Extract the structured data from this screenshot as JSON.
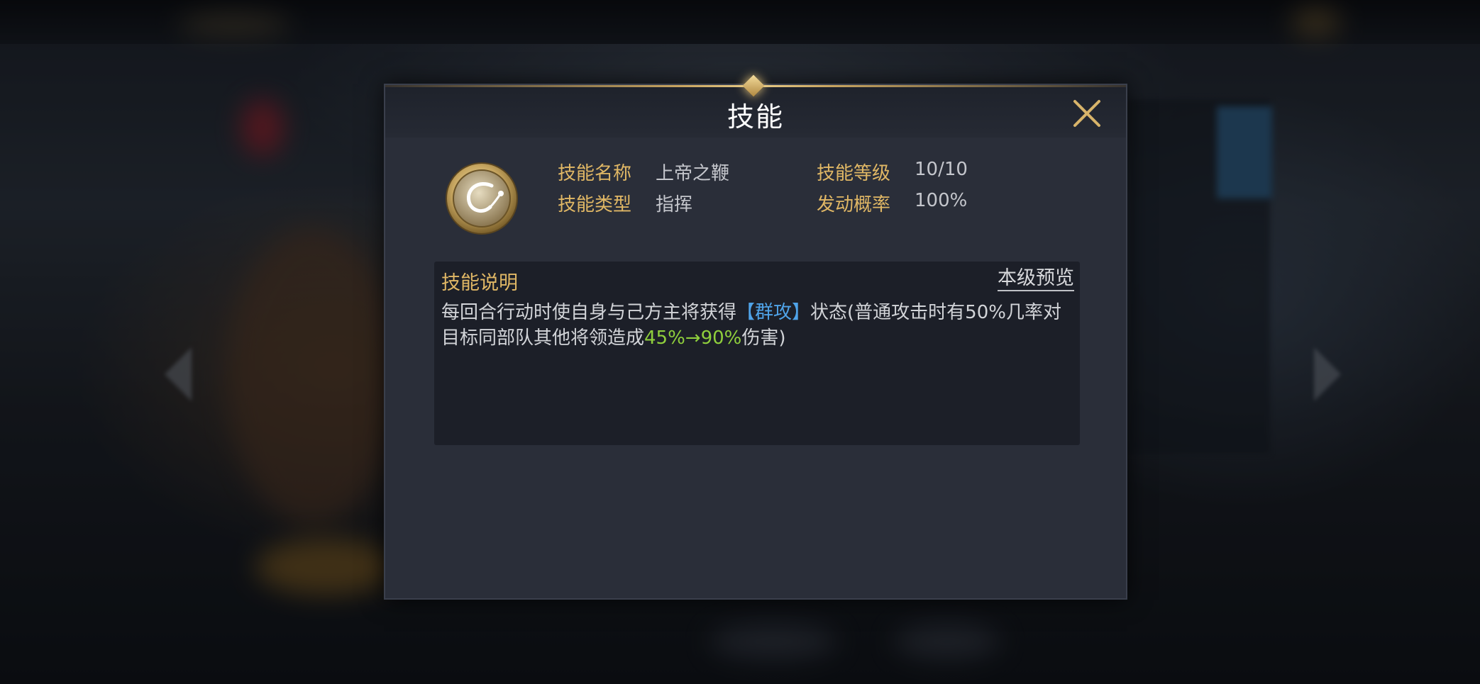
{
  "dialog": {
    "title": "技能",
    "close_icon": "close-x-icon",
    "skill_icon": "whip-emblem-icon"
  },
  "skill_info": {
    "name_label": "技能名称",
    "name_value": "上帝之鞭",
    "level_label": "技能等级",
    "level_value": "10/10",
    "type_label": "技能类型",
    "type_value": "指挥",
    "chance_label": "发动概率",
    "chance_value": "100%"
  },
  "description": {
    "title": "技能说明",
    "preview_link": "本级预览",
    "text_part1": "每回合行动时使自身与己方主将获得",
    "keyword": "【群攻】",
    "text_part2": "状态(普通攻击时有50%几率对目标同部队其他将领造成",
    "damage": "45%→90%",
    "text_part3": "伤害)"
  },
  "colors": {
    "label_gold": "#e0b765",
    "keyword_blue": "#4fa3e8",
    "highlight_green": "#8fcf3c",
    "close_gold": "#d8b46a"
  }
}
